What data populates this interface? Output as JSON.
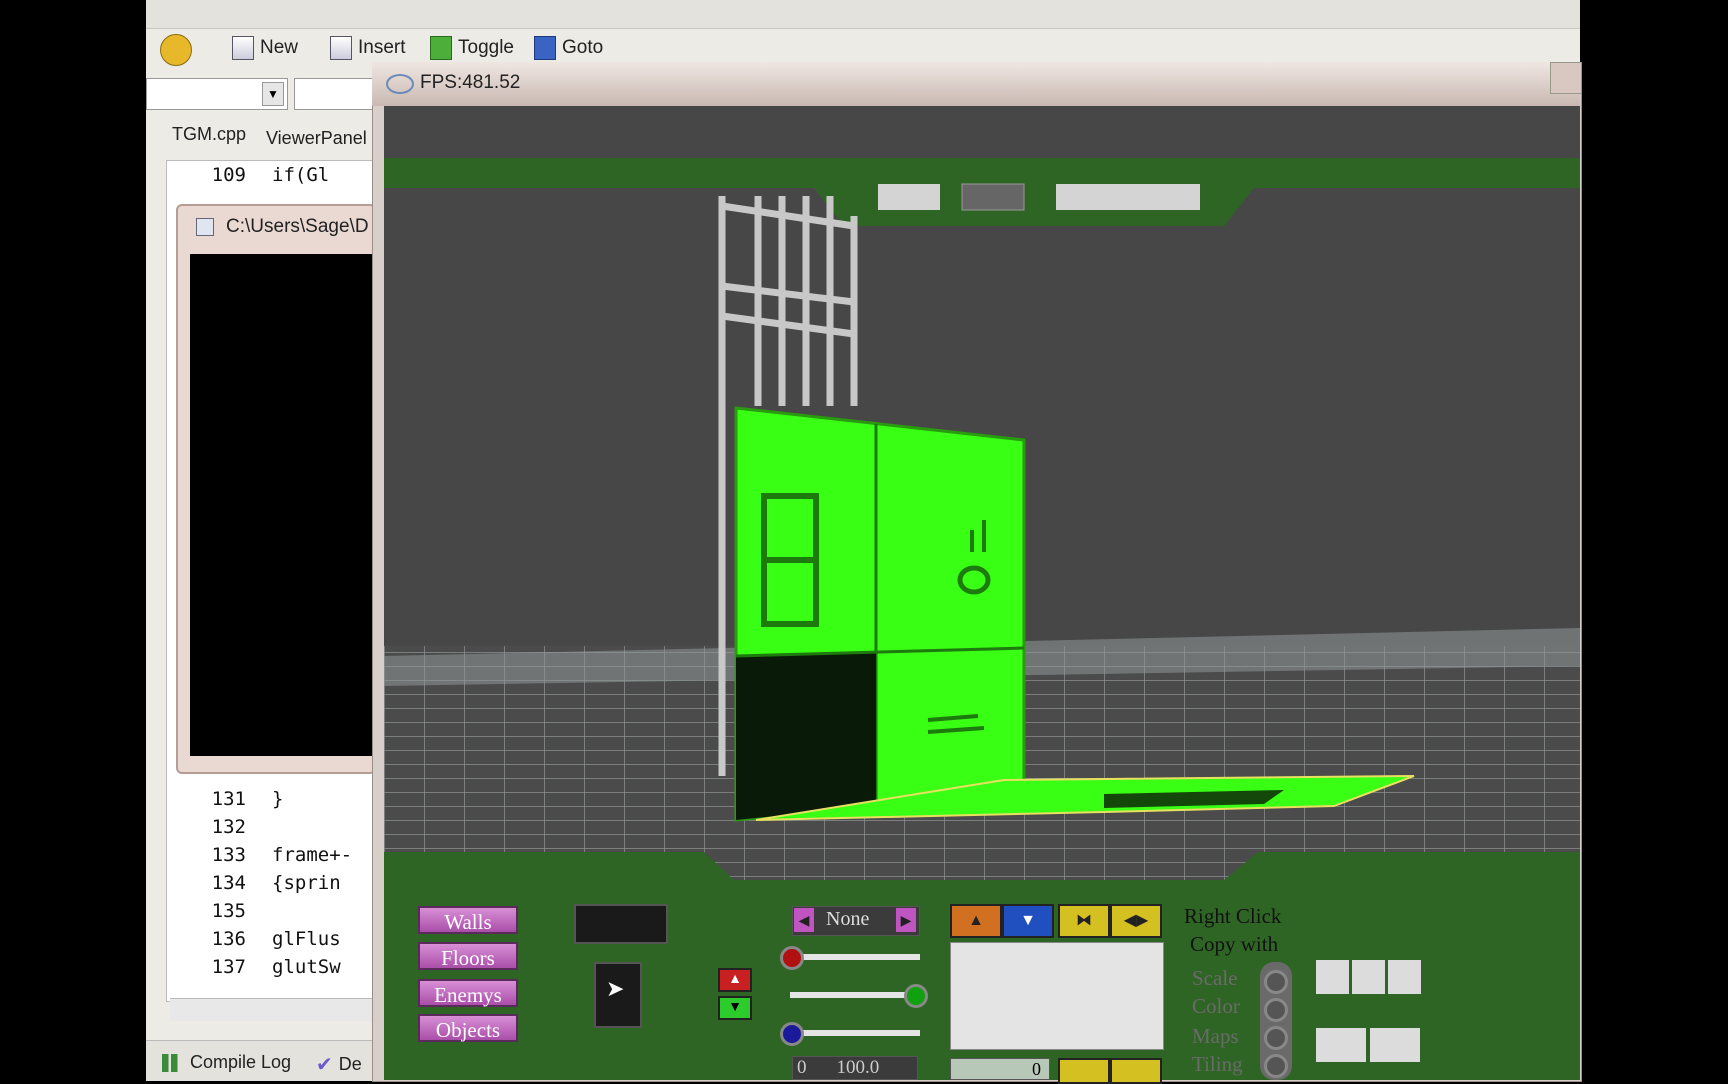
{
  "ide": {
    "toolbar": [
      {
        "label": "New",
        "icon": "new-file-icon"
      },
      {
        "label": "Insert",
        "icon": "insert-icon"
      },
      {
        "label": "Toggle",
        "icon": "toggle-bookmark-icon"
      },
      {
        "label": "Goto",
        "icon": "goto-icon"
      }
    ],
    "tabs": [
      "TGM.cpp",
      "ViewerPanel"
    ],
    "console_title": "C:\\Users\\Sage\\D",
    "code_top": {
      "ln": "109",
      "text": "if(Gl"
    },
    "code_lines": [
      {
        "ln": "131",
        "text": "}"
      },
      {
        "ln": "132",
        "text": ""
      },
      {
        "ln": "133",
        "text": "frame+-"
      },
      {
        "ln": "134",
        "text": "{sprin"
      },
      {
        "ln": "135",
        "text": ""
      },
      {
        "ln": "136",
        "text": "glFlus"
      },
      {
        "ln": "137",
        "text": "glutSw"
      }
    ],
    "bottom_tabs": [
      "Compile Log",
      "De"
    ]
  },
  "glwindow": {
    "title": "FPS:481.52"
  },
  "editor_panel": {
    "category_buttons": [
      "Walls",
      "Floors",
      "Enemys",
      "Objects"
    ],
    "texture_select": "None",
    "right_click_label": "Right Click",
    "copy_with_label": "Copy with",
    "copy_options": [
      "Scale",
      "Color",
      "Maps",
      "Tiling"
    ],
    "range_min": "0",
    "range_max": "100.0",
    "field_value": "0",
    "colors": {
      "panel": "#2f6524",
      "highlight": "#38ff14",
      "floor": "#474747"
    }
  }
}
